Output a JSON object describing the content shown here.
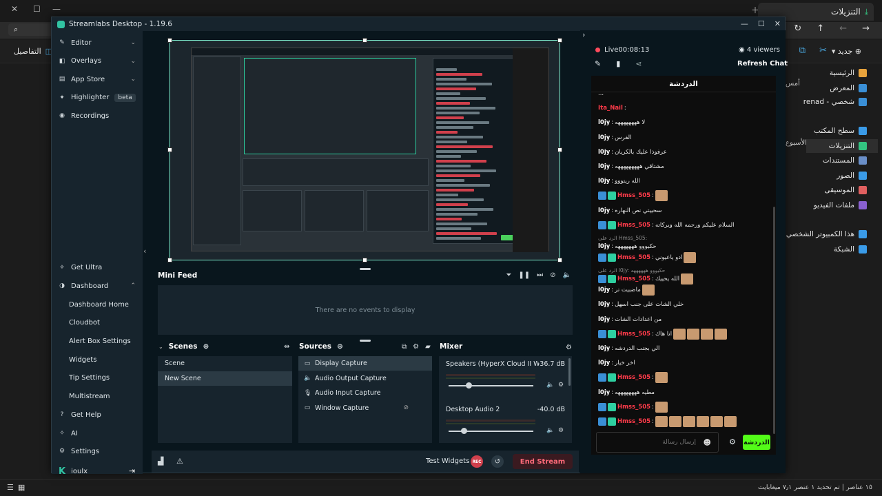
{
  "explorer": {
    "tab_title": "التنزيلات",
    "search_icon": "search-icon",
    "details": "التفاصيل",
    "new_label": "جديد",
    "sidebar": [
      {
        "label": "الرئيسية",
        "color": "#e8a33c"
      },
      {
        "label": "المعرض",
        "color": "#3a8fd6"
      },
      {
        "label": "renad - شخصي",
        "color": "#3a8fd6"
      },
      {
        "label": "سطح المكتب",
        "color": "#3a9be8"
      },
      {
        "label": "التنزيلات",
        "color": "#33c481"
      },
      {
        "label": "المستندات",
        "color": "#6a8fc8"
      },
      {
        "label": "الصور",
        "color": "#3a9be8"
      },
      {
        "label": "الموسيقى",
        "color": "#e06060"
      },
      {
        "label": "ملفات الفيديو",
        "color": "#8a60d0"
      },
      {
        "label": "هذا الكمبيوتر الشخصي",
        "color": "#3a9be8"
      },
      {
        "label": "الشبكة",
        "color": "#3a9be8"
      }
    ],
    "col_labels": [
      "",
      "أمس",
      "",
      "",
      "",
      "الأسبوع",
      "",
      "",
      "",
      "",
      "",
      "",
      "",
      "",
      "",
      ""
    ],
    "status_right": "١٥ عناصر   |   تم تحديد ١ عنصر   ٧٫١ ميغابايت"
  },
  "streamlabs": {
    "title": "Streamlabs Desktop - 1.19.6",
    "nav_top": [
      {
        "label": "Editor",
        "icon": "editor-icon",
        "chevron": true
      },
      {
        "label": "Overlays",
        "icon": "overlays-icon",
        "chevron": true
      },
      {
        "label": "App Store",
        "icon": "app-store-icon",
        "chevron": true
      },
      {
        "label": "Highlighter",
        "icon": "highlighter-icon",
        "chevron": false
      },
      {
        "label": "Recordings",
        "icon": "recordings-icon",
        "chevron": false
      }
    ],
    "beta": "beta",
    "get_ultra": "Get Ultra",
    "dashboard": "Dashboard",
    "dashboard_items": [
      "Dashboard Home",
      "Cloudbot",
      "Alert Box Settings",
      "Widgets",
      "Tip Settings",
      "Multistream"
    ],
    "get_help": "Get Help",
    "ai": "AI",
    "settings": "Settings",
    "user": "ioulx",
    "minifeed": {
      "title": "Mini Feed",
      "empty": "There are no events to display"
    },
    "scenes": {
      "title": "Scenes",
      "items": [
        "Scene",
        "New Scene"
      ],
      "selected": 1
    },
    "sources": {
      "title": "Sources",
      "items": [
        {
          "label": "Display Capture",
          "icon": "monitor-icon"
        },
        {
          "label": "Audio Output Capture",
          "icon": "speaker-icon"
        },
        {
          "label": "Audio Input Capture",
          "icon": "microphone-icon"
        },
        {
          "label": "Window Capture",
          "icon": "window-icon"
        }
      ],
      "selected": 0
    },
    "mixer": {
      "title": "Mixer",
      "channels": [
        {
          "name": "Speakers (HyperX Cloud II Wir...",
          "db": "-36.7 dB",
          "level": 0.2
        },
        {
          "name": "Desktop Audio 2",
          "db": "-40.0 dB",
          "level": 0.15
        }
      ]
    },
    "test_widgets": "Test Widgets",
    "rec": "REC",
    "end_stream": "End Stream"
  },
  "chat": {
    "live": "Live",
    "time": "00:08:13",
    "viewers": "4 viewers",
    "refresh": "Refresh Chat",
    "header": "الدردشة",
    "input_placeholder": "إرسال رسالة",
    "send": "الدردشة",
    "messages": [
      {
        "user": "",
        "text": "...",
        "red": false,
        "badges": false,
        "emotes": 0
      },
      {
        "user": "Ita_Nail",
        "text": "",
        "red": true,
        "badges": false,
        "emotes": 0
      },
      {
        "user": "l0jy",
        "text": "لا ههههههههه",
        "red": false,
        "badges": false,
        "emotes": 0
      },
      {
        "user": "l0jy",
        "text": "الفرس",
        "red": false,
        "badges": false,
        "emotes": 0
      },
      {
        "user": "l0jy",
        "text": "عرفوذا عليك بالكريان",
        "red": false,
        "badges": false,
        "emotes": 0
      },
      {
        "user": "l0jy",
        "text": "مشتاقي هههههههههه",
        "red": false,
        "badges": false,
        "emotes": 0
      },
      {
        "user": "l0jy",
        "text": "الله ريتووو",
        "red": false,
        "badges": false,
        "emotes": 0
      },
      {
        "user": "Hmss_505",
        "text": "",
        "red": true,
        "badges": true,
        "emotes": 1
      },
      {
        "user": "l0jy",
        "text": "سحييتي نص النهاره",
        "red": false,
        "badges": false,
        "emotes": 0
      },
      {
        "user": "Hmss_505",
        "text": "السلام عليكم ورحمه الله وبركاته",
        "red": true,
        "badges": true,
        "emotes": 0
      },
      {
        "user": "l0jy",
        "text": "حكيووو هههههههه",
        "red": false,
        "badges": false,
        "emotes": 0,
        "reply": "الرد على Hmss_505:"
      },
      {
        "user": "Hmss_505",
        "text": "ادو ياعيوني",
        "red": true,
        "badges": true,
        "emotes": 1
      },
      {
        "user": "Hmss_505",
        "text": "الله يحييك",
        "red": true,
        "badges": true,
        "emotes": 1,
        "reply": "الرد على l0jy: حكيووو ههههههه"
      },
      {
        "user": "l0jy",
        "text": "ماضبيت تر",
        "red": false,
        "badges": false,
        "emotes": 1
      },
      {
        "user": "l0jy",
        "text": "خلي الشات على جنب اسهل",
        "red": false,
        "badges": false,
        "emotes": 0
      },
      {
        "user": "l0jy",
        "text": "من اعدادات الشات",
        "red": false,
        "badges": false,
        "emotes": 0
      },
      {
        "user": "Hmss_505",
        "text": "انا هاك",
        "red": true,
        "badges": true,
        "emotes": 4
      },
      {
        "user": "l0jy",
        "text": "الي بجنب الدردشه",
        "red": false,
        "badges": false,
        "emotes": 0
      },
      {
        "user": "l0jy",
        "text": "اخر خيار",
        "red": false,
        "badges": false,
        "emotes": 0
      },
      {
        "user": "Hmss_505",
        "text": "",
        "red": true,
        "badges": true,
        "emotes": 1
      },
      {
        "user": "l0jy",
        "text": "مطيه ههههههههه",
        "red": false,
        "badges": false,
        "emotes": 0
      },
      {
        "user": "Hmss_505",
        "text": "",
        "red": true,
        "badges": true,
        "emotes": 1
      },
      {
        "user": "Hmss_505",
        "text": "",
        "red": true,
        "badges": true,
        "emotes": 6
      }
    ]
  },
  "colors": {
    "accent": "#31c3a2",
    "kick_green": "#53fc18",
    "end_stream": "#ff6b7a",
    "chat_red": "#ff3b4a"
  }
}
